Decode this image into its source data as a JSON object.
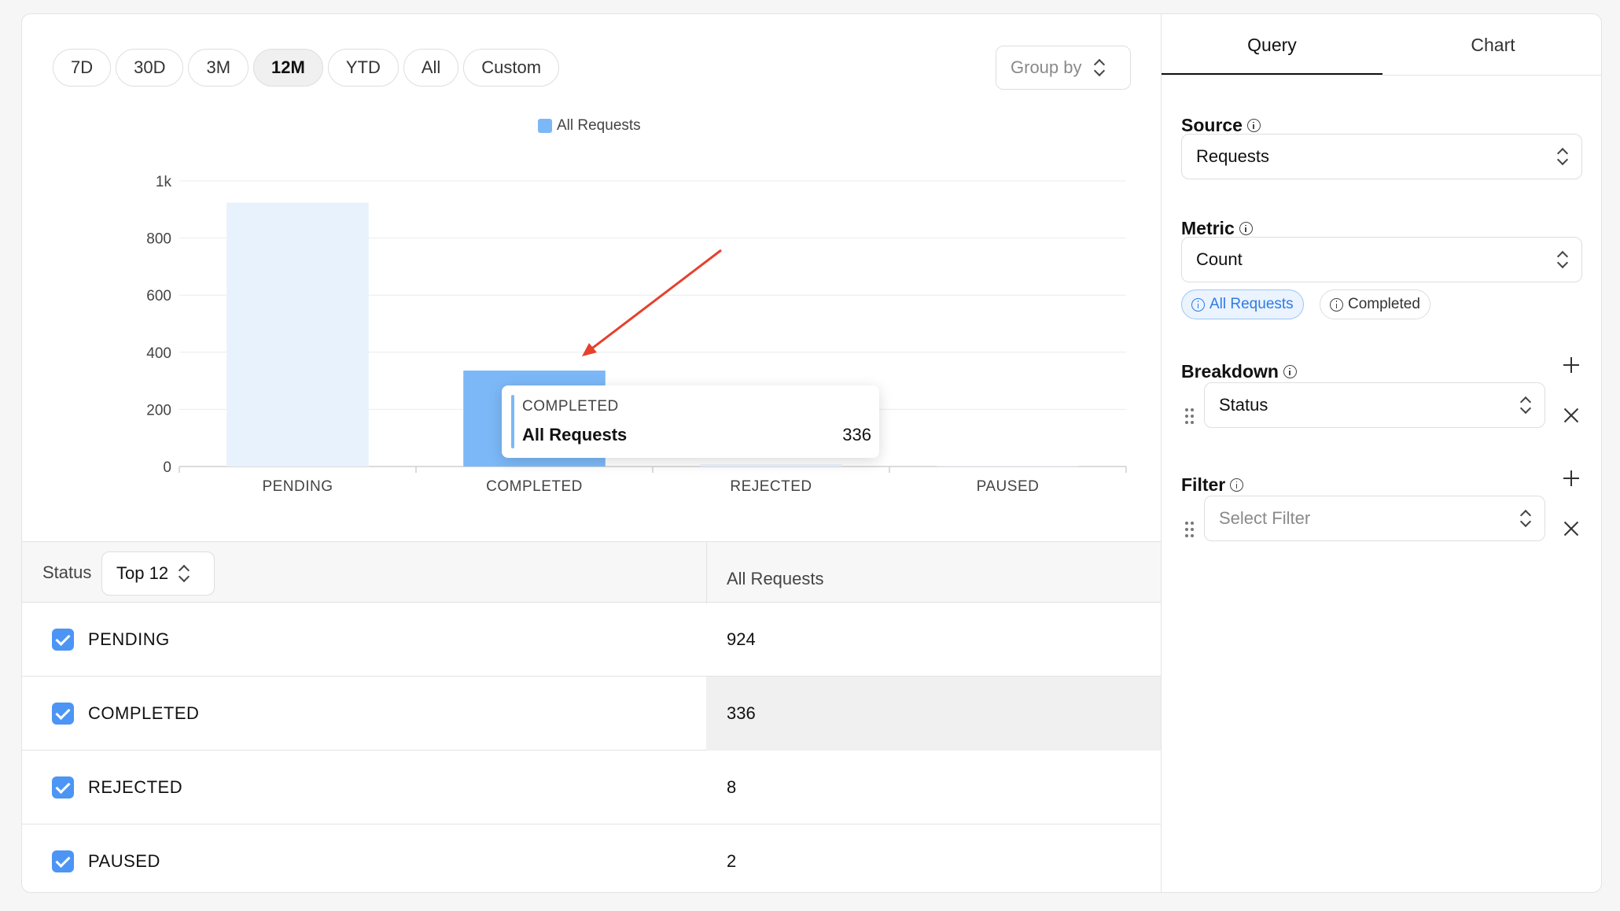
{
  "ranges": [
    {
      "label": "7D",
      "active": false
    },
    {
      "label": "30D",
      "active": false
    },
    {
      "label": "3M",
      "active": false
    },
    {
      "label": "12M",
      "active": true
    },
    {
      "label": "YTD",
      "active": false
    },
    {
      "label": "All",
      "active": false
    },
    {
      "label": "Custom",
      "active": false
    }
  ],
  "group_by": {
    "placeholder": "Group by"
  },
  "chart_data": {
    "type": "bar",
    "categories": [
      "PENDING",
      "COMPLETED",
      "REJECTED",
      "PAUSED"
    ],
    "series": [
      {
        "name": "All Requests",
        "values": [
          924,
          336,
          8,
          2
        ],
        "color": "#7cb8f7"
      }
    ],
    "ylim": [
      0,
      1000
    ],
    "yticks": [
      0,
      200,
      400,
      600,
      800,
      1000
    ],
    "ytick_labels": [
      "0",
      "200",
      "400",
      "600",
      "800",
      "1k"
    ],
    "legend": "top-center",
    "grid": true,
    "highlighted_category": "COMPLETED"
  },
  "tooltip": {
    "category": "COMPLETED",
    "series": "All Requests",
    "value": "336"
  },
  "table": {
    "status_label": "Status",
    "top_n": "Top 12",
    "column_header": "All Requests",
    "rows": [
      {
        "label": "PENDING",
        "value": "924",
        "checked": true
      },
      {
        "label": "COMPLETED",
        "value": "336",
        "checked": true
      },
      {
        "label": "REJECTED",
        "value": "8",
        "checked": true
      },
      {
        "label": "PAUSED",
        "value": "2",
        "checked": true
      }
    ]
  },
  "panel": {
    "tabs": [
      "Query",
      "Chart"
    ],
    "active_tab": "Query",
    "source": {
      "title": "Source",
      "value": "Requests"
    },
    "metric": {
      "title": "Metric",
      "value": "Count",
      "chips": [
        "All Requests",
        "Completed"
      ]
    },
    "breakdown": {
      "title": "Breakdown",
      "value": "Status"
    },
    "filter": {
      "title": "Filter",
      "placeholder": "Select Filter"
    }
  },
  "colors": {
    "accent": "#4c95f5",
    "bar": "#7cb8f7",
    "bar_faded": "#e8f2fd",
    "annotation": "#e5412d"
  }
}
